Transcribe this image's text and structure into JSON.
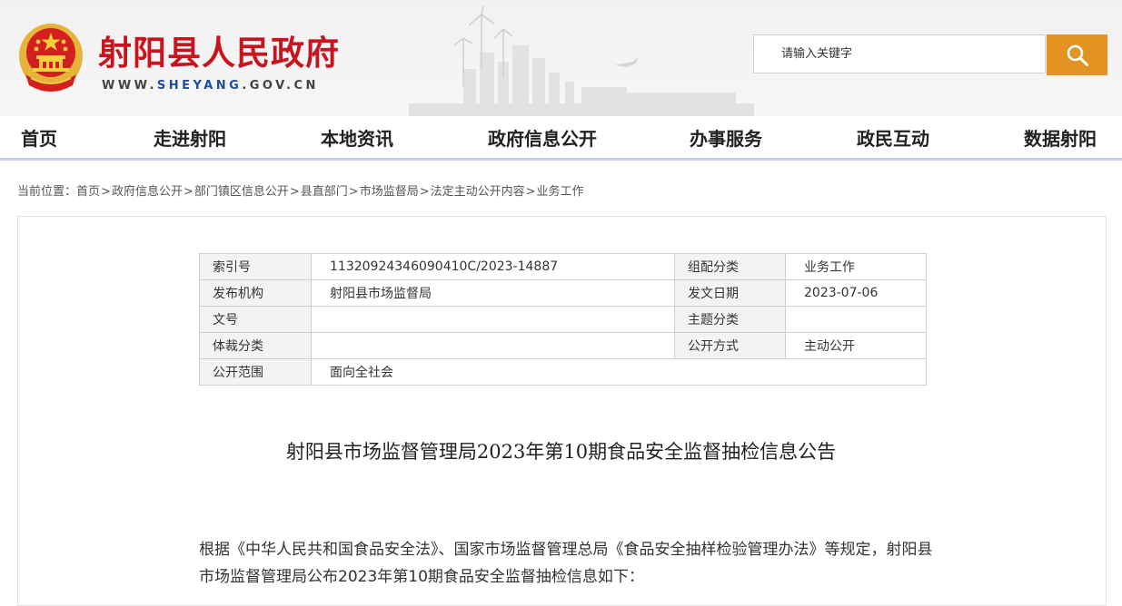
{
  "header": {
    "site_title": "射阳县人民政府",
    "url_prefix": "WWW.",
    "url_highlight": "SHEYANG",
    "url_suffix": ".GOV.CN"
  },
  "search": {
    "placeholder": "请输入关键字",
    "icon": "search-icon",
    "button_color": "#e39321"
  },
  "nav": {
    "items": [
      "首页",
      "走进射阳",
      "本地资讯",
      "政府信息公开",
      "办事服务",
      "政民互动",
      "数据射阳"
    ]
  },
  "breadcrumb": {
    "prefix": "当前位置：",
    "items": [
      "首页",
      "政府信息公开",
      "部门镇区信息公开",
      "县直部门",
      "市场监督局",
      "法定主动公开内容",
      "业务工作"
    ],
    "separator": ">"
  },
  "meta": {
    "rows": [
      [
        "索引号",
        "11320924346090410C/2023-14887",
        "组配分类",
        "业务工作"
      ],
      [
        "发布机构",
        "射阳县市场监督局",
        "发文日期",
        "2023-07-06"
      ],
      [
        "文号",
        "",
        "主题分类",
        ""
      ],
      [
        "体裁分类",
        "",
        "公开方式",
        "主动公开"
      ]
    ],
    "last_row": [
      "公开范围",
      "面向全社会"
    ]
  },
  "article": {
    "title": "射阳县市场监督管理局2023年第10期食品安全监督抽检信息公告",
    "paragraph": "根据《中华人民共和国食品安全法》、国家市场监督管理总局《食品安全抽样检验管理办法》等规定，射阳县市场监督管理局公布2023年第10期食品安全监督抽检信息如下："
  },
  "colors": {
    "brand_red": "#c8141e",
    "url_blue": "#1d4ea0",
    "accent_orange": "#e39321",
    "nav_underline": "#c6d1e8"
  }
}
